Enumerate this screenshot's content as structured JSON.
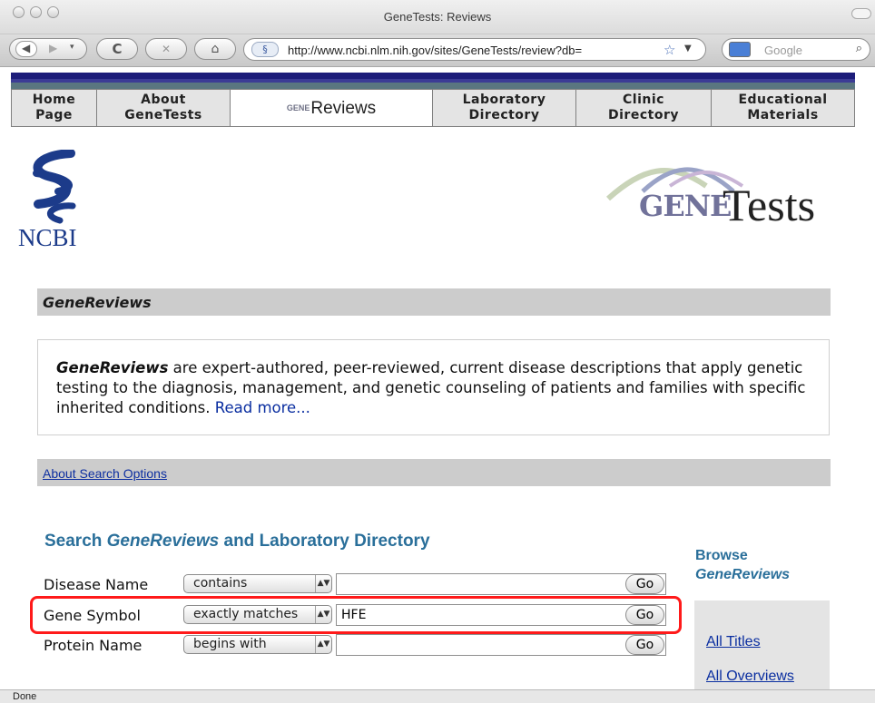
{
  "window": {
    "title": "GeneTests: Reviews"
  },
  "toolbar": {
    "url": "http://www.ncbi.nlm.nih.gov/sites/GeneTests/review?db=",
    "search_placeholder": "Google"
  },
  "nav": {
    "tabs": [
      {
        "label": "Home\nPage"
      },
      {
        "label": "About\nGeneTests"
      },
      {
        "label": "Reviews",
        "prefix": "GENE"
      },
      {
        "label": "Laboratory\nDirectory"
      },
      {
        "label": "Clinic\nDirectory"
      },
      {
        "label": "Educational\nMaterials"
      }
    ]
  },
  "logos": {
    "ncbi": "NCBI",
    "genetests_gene": "GENE",
    "genetests_tests": "Tests"
  },
  "genereviews": {
    "heading": "GeneReviews",
    "description_lead": "GeneReviews",
    "description_body": " are expert-authored, peer-reviewed, current disease descriptions that apply genetic testing to the diagnosis, management, and genetic counseling of patients and families with specific inherited conditions. ",
    "read_more": "Read more..."
  },
  "about_search": "About Search Options",
  "search": {
    "title_prefix": "Search ",
    "title_italic": "GeneReviews",
    "title_suffix": " and Laboratory Directory",
    "rows": [
      {
        "label": "Disease Name",
        "operator": "contains",
        "value": "",
        "go": "Go"
      },
      {
        "label": "Gene Symbol",
        "operator": "exactly matches",
        "value": "HFE",
        "go": "Go"
      },
      {
        "label": "Protein Name",
        "operator": "begins with",
        "value": "",
        "go": "Go"
      }
    ]
  },
  "browse": {
    "heading_line1": "Browse",
    "heading_line2": "GeneReviews",
    "links": [
      "All Titles",
      "All Overviews"
    ]
  },
  "status": "Done",
  "colors": {
    "highlight": "#ff1a1a",
    "heading_teal": "#2a6f9a",
    "link_blue": "#0a2ea0",
    "nav_stripe": "#1d1d7a"
  }
}
